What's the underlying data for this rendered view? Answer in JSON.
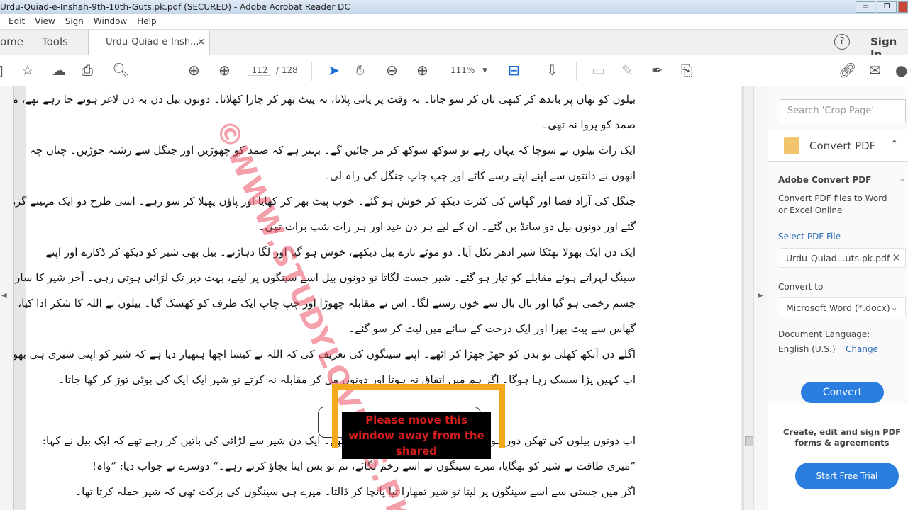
{
  "window": {
    "title": "Urdu-Quiad-e-Inshah-9th-10th-Guts.pk.pdf (SECURED) - Adobe Acrobat Reader DC"
  },
  "menu": [
    "Edit",
    "View",
    "Sign",
    "Window",
    "Help"
  ],
  "tabs": {
    "home": "ome",
    "tools": "Tools",
    "document": "Urdu-Quiad-e-Insh...",
    "close": "×",
    "help": "?",
    "sign_in": "Sign In"
  },
  "toolbar": {
    "page_current": "112",
    "page_total": "/ 128",
    "zoom": "111%"
  },
  "document": {
    "lines": [
      "بیلوں کو تھان پر باندھ کر کبھی تان کر سو جاتا۔ نہ وقت پر پانی پلاتا، نہ پیٹ بھر کر چارا کھلاتا۔ دونوں بیل دن بہ دن لاغر ہوتے جا رہے تھے، مگر",
      "صمد کو پروا نہ تھی۔",
      "ایک رات بیلوں نے سوچا کہ یہاں رہے تو سوکھ سوکھ کر مر جائیں گے۔ بہتر ہے کہ صمد کو چھوڑیں اور جنگل سے رشتہ جوڑیں۔ چناں چہ",
      "انھوں نے دانتوں سے اپنے اپنے رسے کاٹے اور چپ چاپ جنگل کی راہ لی۔",
      "جنگل کی آزاد فضا اور گھاس کی کثرت دیکھ کر خوش ہو گئے۔ خوب پیٹ بھر کر کھایا اور پاؤں پھیلا کر سو رہے۔ اسی طرح دو ایک مہینے گزر",
      "گئے اور دونوں بیل دو سانڈ بن گئے۔ ان کے لیے ہر دن عید اور ہر رات شب برات تھی۔",
      "ایک دن ایک بھولا بھٹکا شیر ادھر نکل آیا۔ دو موٹے تازے بیل دیکھے، خوش ہو گیا اور لگا دہاڑنے۔ بیل بھی شیر کو دیکھ کر ڈکارے اور اپنے",
      "سینگ لہراتے ہوئے مقابلے کو تیار ہو گئے۔ شیر جست لگاتا تو دونوں بیل اسے سینگوں پر لیتے، بہت دیر تک لڑائی ہوتی رہی۔ آخر شیر کا سارا",
      "جسم زخمی ہو گیا اور بال بال سے خون رسنے لگا۔ اس نے مقابلہ چھوڑا اور چپ چاپ ایک طرف کو کھسک گیا۔ بیلوں نے اللہ کا شکر ادا کیا،",
      "گھاس سے پیٹ بھرا اور ایک درخت کے سائے میں لیٹ کر سو گئے۔",
      "اگلے دن آنکھ کھلی تو بدن کو جھڑ جھڑا کر اٹھے۔ اپنے سینگوں کی تعریف کی کہ اللہ نے کیسا اچھا ہتھیار دیا ہے کہ شیر کو اپنی شیری ہی بھول گئی،",
      "اب کہیں پڑا سسک رہا ہوگا۔ اگر ہم میں اتفاق نہ ہوتا اور دونوں مل کر مقابلہ نہ کرتے تو شیر ایک ایک کی بوٹی توڑ کر کھا جاتا۔",
      "",
      "اب دونوں بیلوں کی تھکن دور ہو چلی تھی۔ اپنی طاقت پر مغرور تھے۔ ایک دن شیر سے لڑائی کی باتیں کر رہے تھے کہ ایک بیل نے کہا:",
      "”میری طاقت نے شیر کو بھگایا، میرے سینگوں نے اسے زخم لگائے، تم تو بس اپنا بچاؤ کرتے رہے۔“ دوسرے نے جواب دیا: ”واہ!",
      "اگر میں جستی سے اسے سینگوں پر لیتا تو شیر تمھارا تیا پانچا کر ڈالتا۔ میرے ہی سینگوں کی برکت تھی کہ شیر حملہ کرتا تھا۔"
    ],
    "watermark": "©WWW.STUDYLOVERS.PK",
    "overlay_message": "Please move this window away from the shared"
  },
  "right_pane": {
    "search_placeholder": "Search 'Crop Page'",
    "section_title": "Convert PDF",
    "heading": "Adobe Convert PDF",
    "description": "Convert PDF files to Word or Excel Online",
    "select_file": "Select PDF File",
    "file_name": "Urdu-Quiad...uts.pk.pdf",
    "convert_to_label": "Convert to",
    "convert_to_value": "Microsoft Word (*.docx)",
    "language_label": "Document Language:",
    "language_value": "English (U.S.)",
    "change": "Change",
    "convert_button": "Convert",
    "promo_text": "Create, edit and sign PDF forms & agreements",
    "trial_button": "Start Free Trial"
  }
}
